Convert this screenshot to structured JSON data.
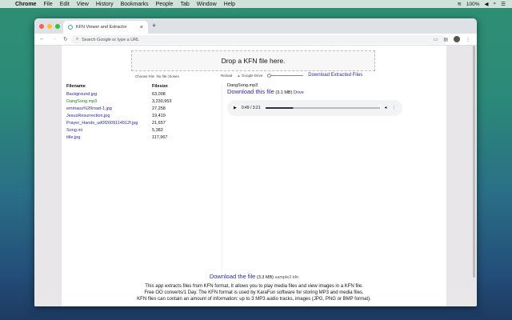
{
  "menubar": {
    "app": "Chrome",
    "items": [
      "File",
      "Edit",
      "View",
      "History",
      "Bookmarks",
      "People",
      "Tab",
      "Window",
      "Help"
    ],
    "battery": "100%"
  },
  "browser": {
    "tab_title": "KFN Viewer and Extractor",
    "omnibox_placeholder": "Search Google or type a URL"
  },
  "page": {
    "drop_label": "Drop a KFN file here.",
    "choose_file": "Choose File",
    "no_file": "No file chosen",
    "reload": "Reload",
    "google_drive": "Google Drive",
    "download_extracted": "Download Extracted Files",
    "table": {
      "headers": [
        "Filename",
        "Filesize"
      ],
      "rows": [
        {
          "name": "Background.jpg",
          "size": "63,008",
          "color": "#2a2aaa"
        },
        {
          "name": "DangSong.mp3",
          "size": "3,230,953",
          "color": "#2a7a2a"
        },
        {
          "name": "emmaus%20road-1.jpg",
          "size": "27,258",
          "color": "#2a2aaa"
        },
        {
          "name": "JesusResurrection.jpg",
          "size": "19,419",
          "color": "#2a2aaa"
        },
        {
          "name": "Prayer_Hands_ud0f2009114912f.jpg",
          "size": "21,657",
          "color": "#2a2aaa"
        },
        {
          "name": "Song.ini",
          "size": "5,382",
          "color": "#2a2aaa"
        },
        {
          "name": "title.jpg",
          "size": "117,967",
          "color": "#2a2aaa"
        }
      ]
    },
    "selected_file": "DangSong.mp3",
    "download_this": "Download this file",
    "this_size": "(3.1 MB)",
    "drive": "Drive",
    "audio": {
      "time": "0:49 / 3:21",
      "progress": 0.24
    },
    "download_file": "Download the file",
    "file_size": "(3.3 MB)",
    "file_name": "sample2.kfn",
    "description": [
      "This app extracts files from KFN format, It allows you to play media files and view images in a KFN file.",
      "Free OO converts/1 Day. The KFN format is used by KaraFun software for storing MP3 and media files.",
      "KFN files can contain an amount of information: up to 3 MP3 audio tracks, images (JPG, PNG or BMP format)."
    ]
  }
}
